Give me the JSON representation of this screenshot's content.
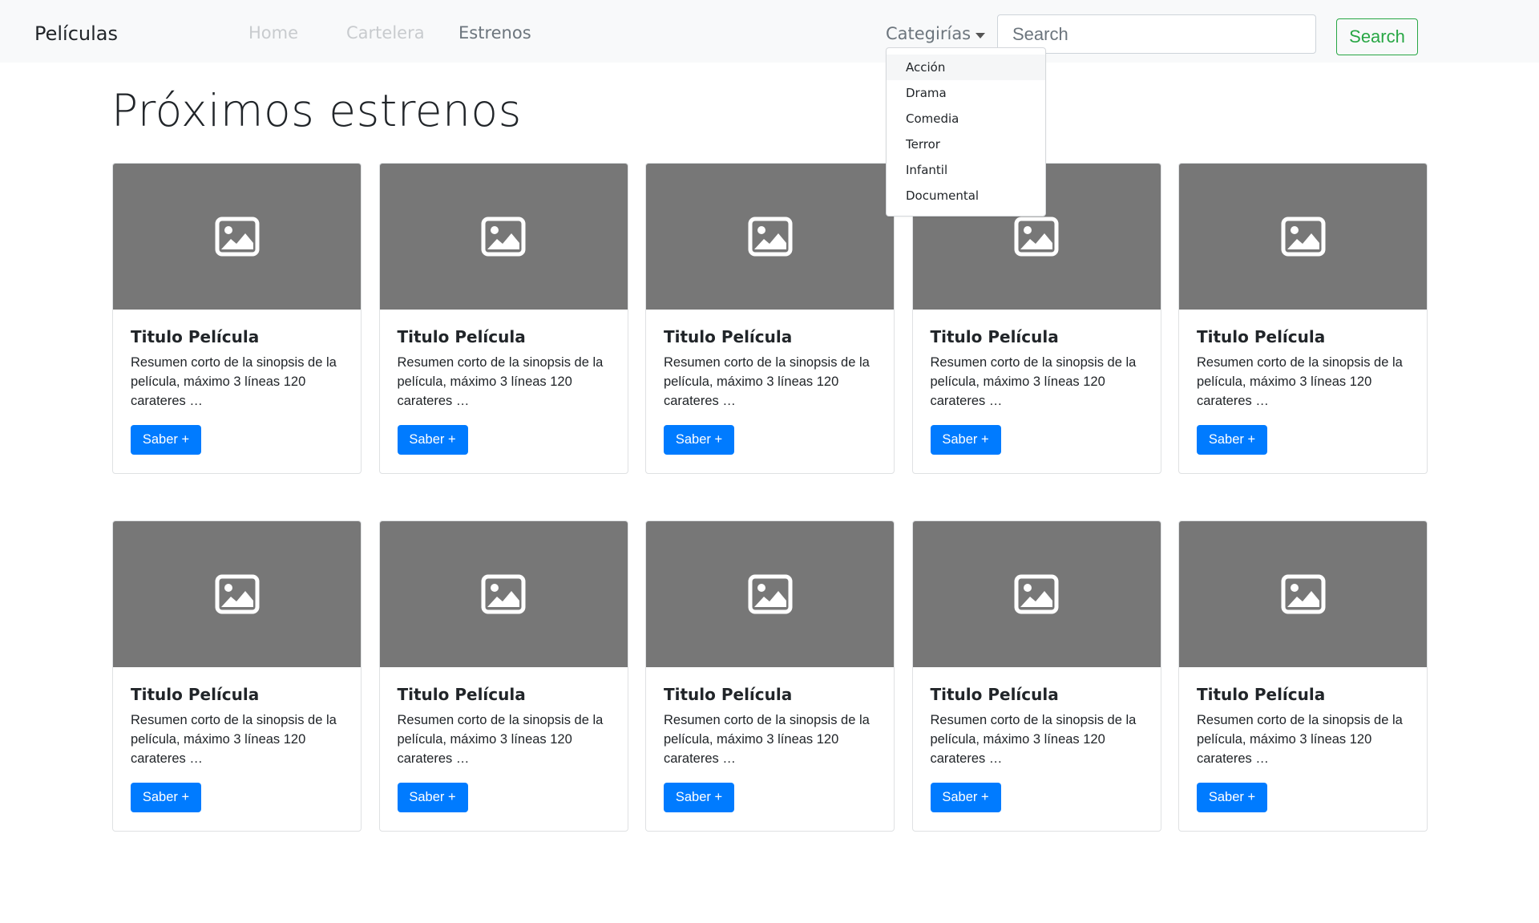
{
  "navbar": {
    "brand": "Películas",
    "links": {
      "home": "Home",
      "cartelera": "Cartelera",
      "estrenos": "Estrenos"
    },
    "dropdown_label": "Categirías",
    "search_placeholder": "Search",
    "search_button": "Search"
  },
  "dropdown": {
    "items": [
      "Acción",
      "Drama",
      "Comedia",
      "Terror",
      "Infantil",
      "Documental"
    ]
  },
  "page_title": "Próximos estrenos",
  "cards": [
    {
      "title": "Titulo Película",
      "text": "Resumen corto de la sinopsis de la película, máximo 3 líneas 120 carateres …",
      "button": "Saber +"
    },
    {
      "title": "Titulo Película",
      "text": "Resumen corto de la sinopsis de la película, máximo 3 líneas 120 carateres …",
      "button": "Saber +"
    },
    {
      "title": "Titulo Película",
      "text": "Resumen corto de la sinopsis de la película, máximo 3 líneas 120 carateres …",
      "button": "Saber +"
    },
    {
      "title": "Titulo Película",
      "text": "Resumen corto de la sinopsis de la película, máximo 3 líneas 120 carateres …",
      "button": "Saber +"
    },
    {
      "title": "Titulo Película",
      "text": "Resumen corto de la sinopsis de la película, máximo 3 líneas 120 carateres …",
      "button": "Saber +"
    },
    {
      "title": "Titulo Película",
      "text": "Resumen corto de la sinopsis de la película, máximo 3 líneas 120 carateres …",
      "button": "Saber +"
    },
    {
      "title": "Titulo Película",
      "text": "Resumen corto de la sinopsis de la película, máximo 3 líneas 120 carateres …",
      "button": "Saber +"
    },
    {
      "title": "Titulo Película",
      "text": "Resumen corto de la sinopsis de la película, máximo 3 líneas 120 carateres …",
      "button": "Saber +"
    },
    {
      "title": "Titulo Película",
      "text": "Resumen corto de la sinopsis de la película, máximo 3 líneas 120 carateres …",
      "button": "Saber +"
    },
    {
      "title": "Titulo Película",
      "text": "Resumen corto de la sinopsis de la película, máximo 3 líneas 120 carateres …",
      "button": "Saber +"
    }
  ],
  "colors": {
    "navbar_bg": "#f8f9fa",
    "primary": "#007bff",
    "success": "#28a745",
    "placeholder_img": "#777777"
  },
  "icons": {
    "card_image": "image-placeholder-icon",
    "dropdown_caret": "caret-down-icon"
  }
}
